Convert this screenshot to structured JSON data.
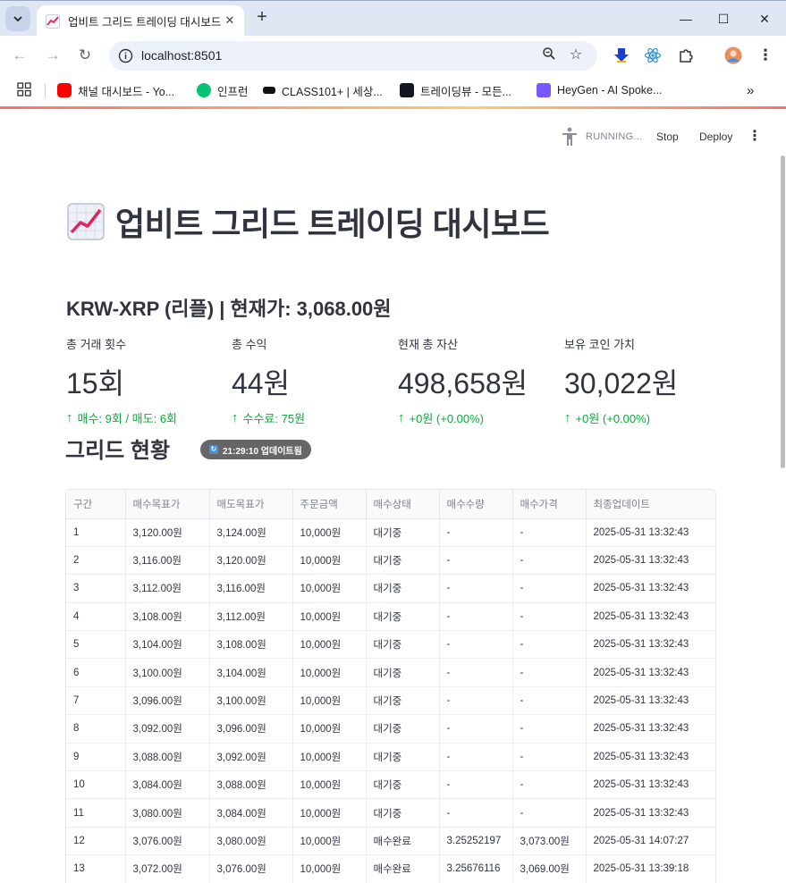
{
  "browser": {
    "tab_title": "업비트 그리드 트레이딩 대시보드",
    "url": "localhost:8501",
    "bookmarks": [
      {
        "label": "채널 대시보드 - Yo...",
        "icon": "youtube-icon",
        "color": "#ff0000"
      },
      {
        "label": "인프런",
        "icon": "inflearn-icon",
        "color": "#00c471"
      },
      {
        "label": "CLASS101+ | 세상...",
        "icon": "class101-icon",
        "color": "#111111"
      },
      {
        "label": "트레이딩뷰 - 모든...",
        "icon": "tradingview-icon",
        "color": "#131722"
      },
      {
        "label": "HeyGen - AI Spoke...",
        "icon": "heygen-icon",
        "color": "#7559ff"
      }
    ]
  },
  "app_header": {
    "status": "RUNNING...",
    "stop_label": "Stop",
    "deploy_label": "Deploy"
  },
  "page": {
    "title": "업비트 그리드 트레이딩 대시보드",
    "subheader": "KRW-XRP (리플) | 현재가: 3,068.00원"
  },
  "metrics": [
    {
      "label": "총 거래 횟수",
      "value": "15회",
      "delta": "매수: 9회 / 매도: 6회"
    },
    {
      "label": "총 수익",
      "value": "44원",
      "delta": "수수료: 75원"
    },
    {
      "label": "현재 총 자산",
      "value": "498,658원",
      "delta": "+0원 (+0.00%)"
    },
    {
      "label": "보유 코인 가치",
      "value": "30,022원",
      "delta": "+0원 (+0.00%)"
    }
  ],
  "grid": {
    "title": "그리드 현황",
    "update_badge": "21:29:10 업데이트됨",
    "columns": [
      "구간",
      "매수목표가",
      "매도목표가",
      "주문금액",
      "매수상태",
      "매수수량",
      "매수가격",
      "최종업데이트"
    ],
    "rows": [
      [
        "1",
        "3,120.00원",
        "3,124.00원",
        "10,000원",
        "대기중",
        "-",
        "-",
        "2025-05-31 13:32:43"
      ],
      [
        "2",
        "3,116.00원",
        "3,120.00원",
        "10,000원",
        "대기중",
        "-",
        "-",
        "2025-05-31 13:32:43"
      ],
      [
        "3",
        "3,112.00원",
        "3,116.00원",
        "10,000원",
        "대기중",
        "-",
        "-",
        "2025-05-31 13:32:43"
      ],
      [
        "4",
        "3,108.00원",
        "3,112.00원",
        "10,000원",
        "대기중",
        "-",
        "-",
        "2025-05-31 13:32:43"
      ],
      [
        "5",
        "3,104.00원",
        "3,108.00원",
        "10,000원",
        "대기중",
        "-",
        "-",
        "2025-05-31 13:32:43"
      ],
      [
        "6",
        "3,100.00원",
        "3,104.00원",
        "10,000원",
        "대기중",
        "-",
        "-",
        "2025-05-31 13:32:43"
      ],
      [
        "7",
        "3,096.00원",
        "3,100.00원",
        "10,000원",
        "대기중",
        "-",
        "-",
        "2025-05-31 13:32:43"
      ],
      [
        "8",
        "3,092.00원",
        "3,096.00원",
        "10,000원",
        "대기중",
        "-",
        "-",
        "2025-05-31 13:32:43"
      ],
      [
        "9",
        "3,088.00원",
        "3,092.00원",
        "10,000원",
        "대기중",
        "-",
        "-",
        "2025-05-31 13:32:43"
      ],
      [
        "10",
        "3,084.00원",
        "3,088.00원",
        "10,000원",
        "대기중",
        "-",
        "-",
        "2025-05-31 13:32:43"
      ],
      [
        "11",
        "3,080.00원",
        "3,084.00원",
        "10,000원",
        "대기중",
        "-",
        "-",
        "2025-05-31 13:32:43"
      ],
      [
        "12",
        "3,076.00원",
        "3,080.00원",
        "10,000원",
        "매수완료",
        "3.25252197",
        "3,073.00원",
        "2025-05-31 14:07:27"
      ],
      [
        "13",
        "3,072.00원",
        "3,076.00원",
        "10,000원",
        "매수완료",
        "3.25676116",
        "3,069.00원",
        "2025-05-31 13:39:18"
      ]
    ]
  },
  "colors": {
    "accent": "#ff4b4b",
    "positive": "#09ab3b",
    "text": "#31333f"
  }
}
